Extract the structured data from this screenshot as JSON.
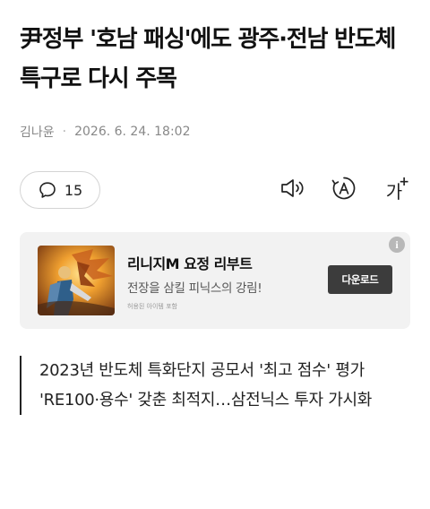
{
  "article": {
    "headline": "尹정부 '호남 패싱'에도 광주·전남 반도체 특구로 다시 주목",
    "author": "김나윤",
    "separator": "·",
    "datetime": "2026. 6. 24. 18:02"
  },
  "toolbar": {
    "comment_count": "15",
    "audio_icon": "speaker-icon",
    "translate_icon": "translate-icon",
    "font_label": "가",
    "font_plus": "+"
  },
  "ad": {
    "title": "리니지M 요정 리부트",
    "description": "전장을 삼킬 피닉스의 강림!",
    "fine_print": "허용된 아이템 포함",
    "button_label": "다운로드",
    "info_label": "i"
  },
  "summary": {
    "lines": [
      "2023년 반도체 특화단지 공모서 '최고 점수' 평가",
      "'RE100·용수' 갖춘 최적지…삼전닉스 투자 가시화"
    ]
  }
}
